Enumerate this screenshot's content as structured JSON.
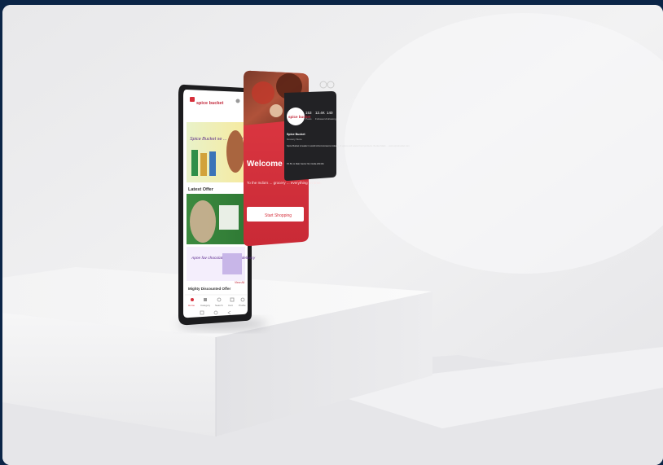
{
  "phone": {
    "brand_logo": "spice bucket",
    "banner_text": "Spice Bucket se ... pe ghar ki tarah",
    "latest_offer_label": "Latest Offer",
    "offer_banner_text": "Apne fav chocolates... bhi ... delivery",
    "discount_label": "Mighty Discounted Offer",
    "view_all_label": "View All",
    "nav": [
      "Home",
      "Category",
      "Search",
      "Cart",
      "Profile"
    ]
  },
  "welcome_card": {
    "title": "Welcome",
    "body": "To the India's ... grocery ... everything on time.",
    "button": "Start Shopping"
  },
  "profile_card": {
    "logo": "spice bucket",
    "stats": [
      {
        "value": "153",
        "label": "Posts"
      },
      {
        "value": "12.4K",
        "label": "Followers"
      },
      {
        "value": "140",
        "label": "Following"
      }
    ],
    "name": "Spice Bucket",
    "category": "Grocery Store",
    "bio": "Spice Bucket is leader in world of E-Commerce industry of spices and related food products. Bucket Made ... www.spicebucket.com",
    "address": "Ph.56, H Mall, Sector 62, Noida 201301"
  },
  "colors": {
    "welcome_red": "#d62f3b",
    "profile_dark": "#222225",
    "phone_body": "#1c1c1e",
    "page_border": "#0b2547"
  }
}
